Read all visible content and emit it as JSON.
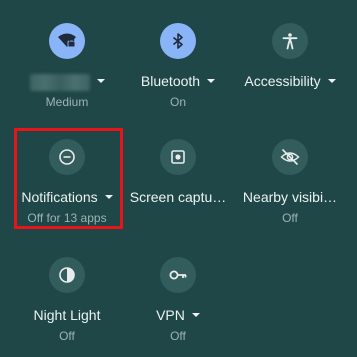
{
  "tiles": [
    {
      "id": "wifi",
      "label": "",
      "sub": "Medium",
      "has_caret": true,
      "active": true,
      "icon": "wifi-lock-icon"
    },
    {
      "id": "bluetooth",
      "label": "Bluetooth",
      "sub": "On",
      "has_caret": true,
      "active": true,
      "icon": "bluetooth-icon"
    },
    {
      "id": "accessibility",
      "label": "Accessibility",
      "sub": "",
      "has_caret": true,
      "active": false,
      "icon": "accessibility-icon"
    },
    {
      "id": "notifications",
      "label": "Notifications",
      "sub": "Off for 13 apps",
      "has_caret": true,
      "active": false,
      "icon": "do-not-disturb-icon"
    },
    {
      "id": "screen_capture",
      "label": "Screen captu…",
      "sub": "",
      "has_caret": false,
      "active": false,
      "icon": "screen-capture-icon"
    },
    {
      "id": "nearby",
      "label": "Nearby visibi…",
      "sub": "Off",
      "has_caret": false,
      "active": false,
      "icon": "visibility-off-icon"
    },
    {
      "id": "night_light",
      "label": "Night Light",
      "sub": "Off",
      "has_caret": false,
      "active": false,
      "icon": "night-light-icon"
    },
    {
      "id": "vpn",
      "label": "VPN",
      "sub": "Off",
      "has_caret": true,
      "active": false,
      "icon": "vpn-key-icon"
    }
  ],
  "colors": {
    "background": "#1f4747",
    "tile_inactive": "#335c5c",
    "tile_active": "#8ab4f8",
    "highlight": "#e8141a"
  }
}
